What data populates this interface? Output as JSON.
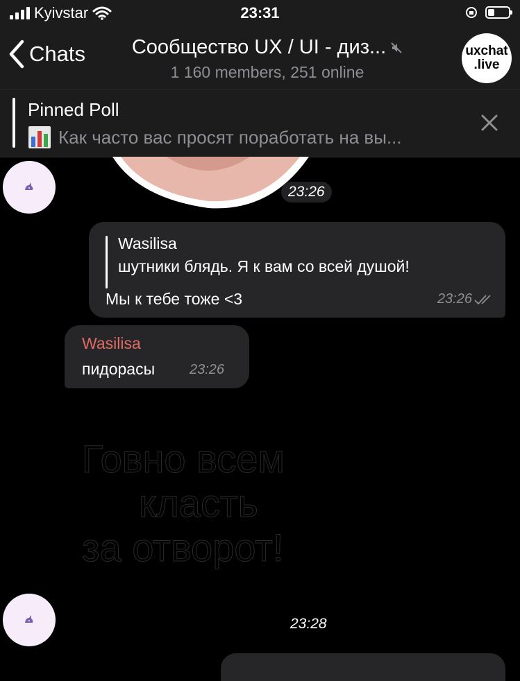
{
  "status_bar": {
    "carrier": "Kyivstar",
    "time": "23:31"
  },
  "header": {
    "back_label": "Chats",
    "title": "Сообщество UX / UI - диз...",
    "subtitle": "1 160 members, 251 online",
    "logo_line1": "uxchat",
    "logo_line2": ".live"
  },
  "pinned": {
    "title": "Pinned Poll",
    "text": "Как часто вас просят поработать на вы..."
  },
  "messages": {
    "sticker_time": "23:26",
    "outgoing": {
      "reply_name": "Wasilisa",
      "reply_text": "шутники блядь. Я к вам со всей душой!",
      "text": "Мы к тебе тоже <3",
      "time": "23:26"
    },
    "incoming": {
      "sender": "Wasilisa",
      "text": "пидорасы",
      "time": "23:26"
    },
    "sticker_text": {
      "line1": "Говно всем",
      "line2": "класть",
      "line3": "за отворот!"
    },
    "sticker2_time": "23:28"
  },
  "colors": {
    "accent_name": "#e26a64",
    "bubble": "#262628",
    "bar": "#1c1c1d"
  }
}
